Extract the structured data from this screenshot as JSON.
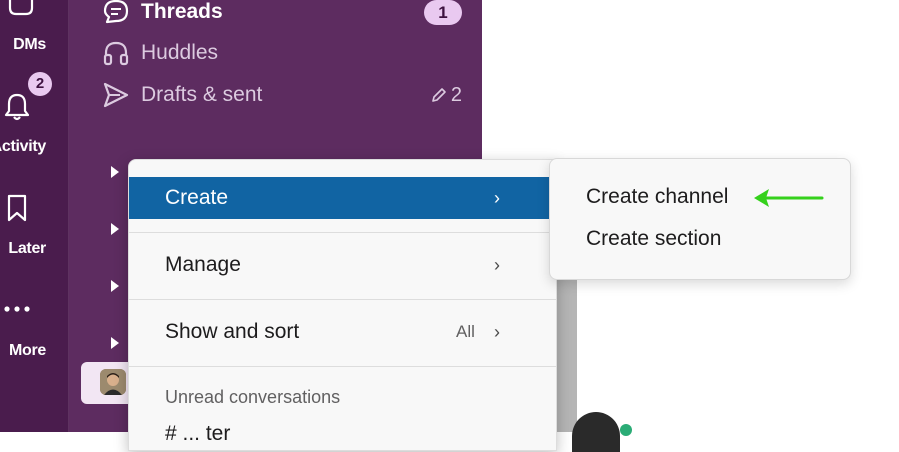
{
  "rail": {
    "items": [
      {
        "label": "DMs",
        "icon": "dms-icon"
      },
      {
        "label": "Activity",
        "icon": "bell-icon",
        "badge": "2"
      },
      {
        "label": "Later",
        "icon": "bookmark-icon"
      },
      {
        "label": "More",
        "icon": "more-icon"
      }
    ]
  },
  "sidebar": {
    "nav": [
      {
        "label": "Threads",
        "icon": "threads-icon",
        "badge": "1"
      },
      {
        "label": "Huddles",
        "icon": "headphones-icon"
      },
      {
        "label": "Drafts & sent",
        "icon": "send-icon",
        "count": "2"
      }
    ]
  },
  "context_menu": {
    "items": [
      {
        "label": "Create",
        "active": true
      },
      {
        "label": "Manage"
      },
      {
        "label": "Show and sort",
        "value": "All"
      }
    ],
    "section_header": "Unread conversations",
    "clipped_item": "# ... ter"
  },
  "submenu": {
    "items": [
      {
        "label": "Create channel"
      },
      {
        "label": "Create section"
      }
    ]
  },
  "colors": {
    "rail_bg": "#4a1c4d",
    "sidebar_bg": "#5d2c60",
    "active_blue": "#1164a3",
    "badge_bg": "#e9c9f0",
    "arrow_green": "#35d11c"
  }
}
